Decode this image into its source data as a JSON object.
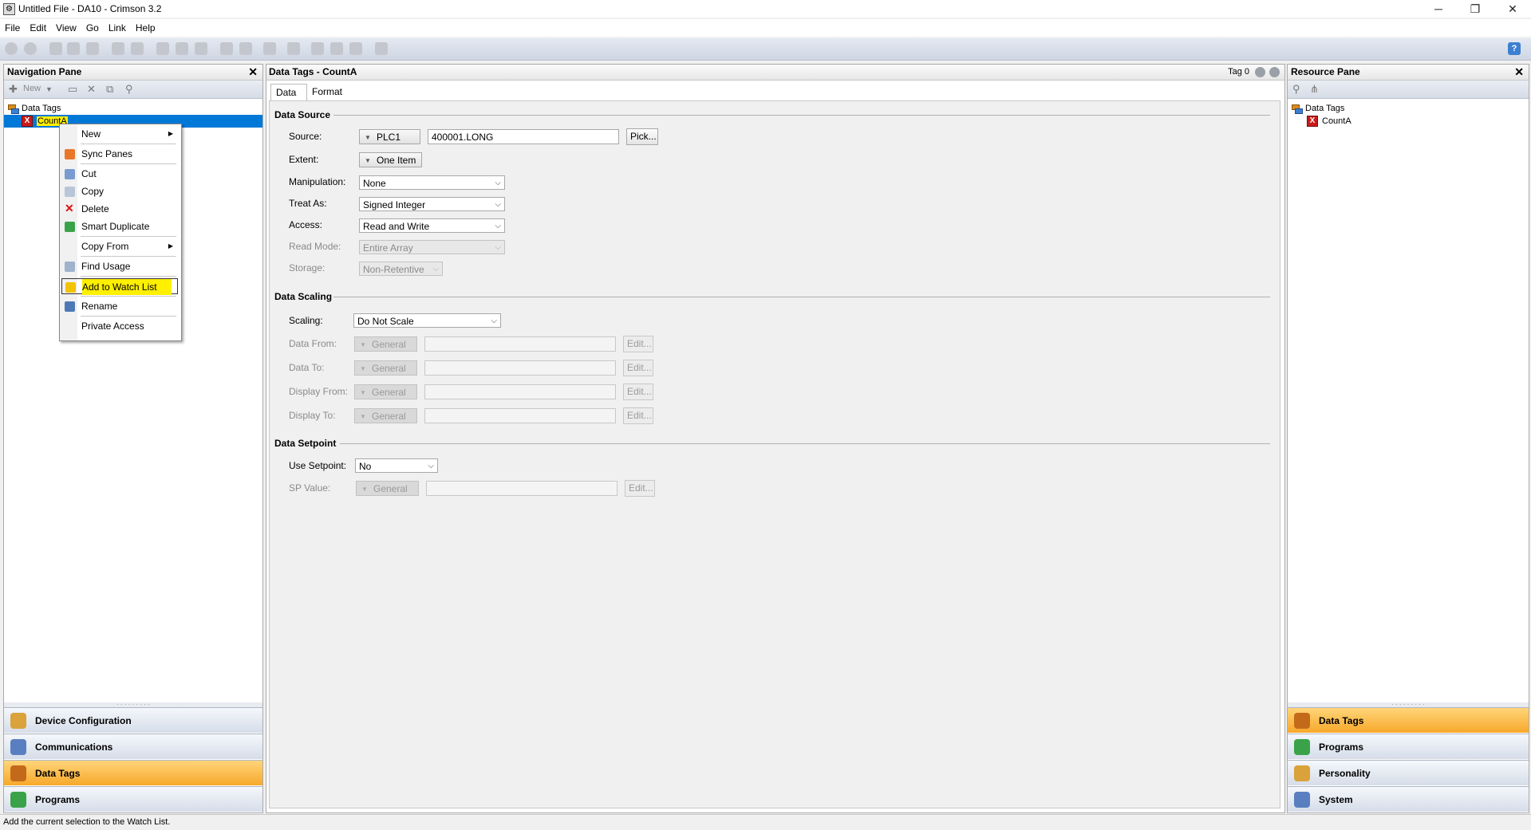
{
  "window": {
    "title": "Untitled File - DA10 - Crimson 3.2",
    "minimize": "─",
    "restore": "❐",
    "close": "✕"
  },
  "menu": [
    "File",
    "Edit",
    "View",
    "Go",
    "Link",
    "Help"
  ],
  "nav_pane": {
    "title": "Navigation Pane",
    "close": "✕",
    "toolbar_new": "New",
    "tree": {
      "root": "Data Tags",
      "child": "CountA"
    },
    "categories": [
      "Device Configuration",
      "Communications",
      "Data Tags",
      "Programs"
    ],
    "selected_category": "Data Tags"
  },
  "context_menu": {
    "items": [
      {
        "label": "New",
        "submenu": true
      },
      {
        "label": "Sync Panes"
      },
      {
        "label": "Cut"
      },
      {
        "label": "Copy"
      },
      {
        "label": "Delete"
      },
      {
        "label": "Smart Duplicate"
      },
      {
        "label": "Copy From",
        "submenu": true
      },
      {
        "label": "Find Usage"
      },
      {
        "label": "Add to Watch List",
        "highlighted": true
      },
      {
        "label": "Rename"
      },
      {
        "label": "Private Access"
      }
    ],
    "submenu_arrow": "▶"
  },
  "editor": {
    "header": "Data Tags - CountA",
    "tag_number": "Tag 0",
    "tabs": [
      "Data",
      "Format"
    ],
    "active_tab": "Data",
    "data_source": {
      "title": "Data Source",
      "source_label": "Source:",
      "source_device": "PLC1",
      "source_address": "400001.LONG",
      "pick_button": "Pick...",
      "extent_label": "Extent:",
      "extent_value": "One Item",
      "manipulation_label": "Manipulation:",
      "manipulation_value": "None",
      "treat_as_label": "Treat As:",
      "treat_as_value": "Signed Integer",
      "access_label": "Access:",
      "access_value": "Read and Write",
      "read_mode_label": "Read Mode:",
      "read_mode_value": "Entire Array",
      "storage_label": "Storage:",
      "storage_value": "Non-Retentive"
    },
    "data_scaling": {
      "title": "Data Scaling",
      "scaling_label": "Scaling:",
      "scaling_value": "Do Not Scale",
      "rows": [
        {
          "label": "Data From:",
          "mode": "General",
          "edit": "Edit..."
        },
        {
          "label": "Data To:",
          "mode": "General",
          "edit": "Edit..."
        },
        {
          "label": "Display From:",
          "mode": "General",
          "edit": "Edit..."
        },
        {
          "label": "Display To:",
          "mode": "General",
          "edit": "Edit..."
        }
      ]
    },
    "data_setpoint": {
      "title": "Data Setpoint",
      "use_setpoint_label": "Use Setpoint:",
      "use_setpoint_value": "No",
      "sp_value_label": "SP Value:",
      "sp_mode": "General",
      "sp_edit": "Edit..."
    }
  },
  "resource_pane": {
    "title": "Resource Pane",
    "close": "✕",
    "tree": {
      "root": "Data Tags",
      "child": "CountA"
    },
    "categories": [
      "Data Tags",
      "Programs",
      "Personality",
      "System"
    ],
    "selected_category": "Data Tags"
  },
  "status_bar": {
    "text": "Add the current selection to the Watch List."
  },
  "colors": {
    "selection_blue": "#0078d7",
    "category_selected": "#f7a82a",
    "highlight_yellow": "#ffef00",
    "delete_red": "#c81b1b"
  }
}
